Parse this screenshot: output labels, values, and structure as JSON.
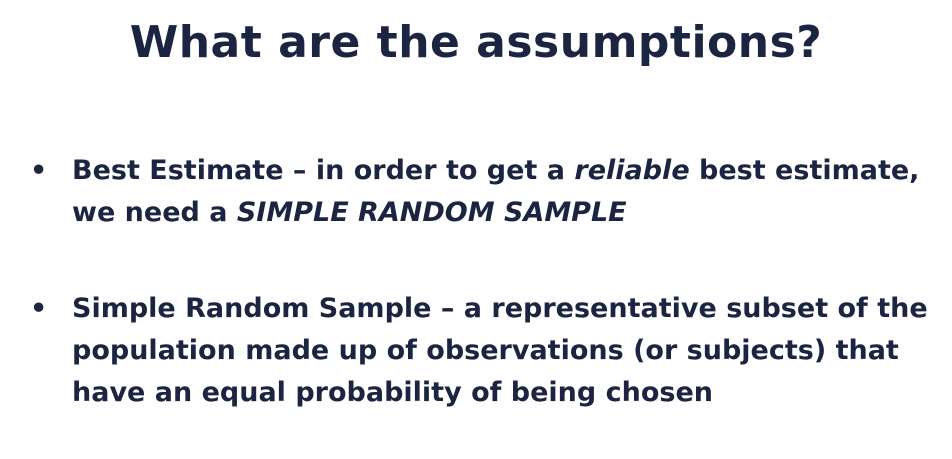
{
  "slide": {
    "title": "What are the assumptions?",
    "bullets": [
      {
        "marker": "•",
        "term": "Best Estimate",
        "dash": " – ",
        "text_before": "in order to get a ",
        "emphasis": "reliable",
        "text_after": " best estimate, we need a ",
        "emphasis_2": "SIMPLE RANDOM SAMPLE"
      },
      {
        "marker": "•",
        "term": "Simple Random Sample",
        "dash": " – ",
        "text": "a representative subset of the population made up of observations (or subjects) that have an equal probability of being chosen"
      }
    ]
  },
  "colors": {
    "text": "#1b2541",
    "background": "#ffffff"
  }
}
